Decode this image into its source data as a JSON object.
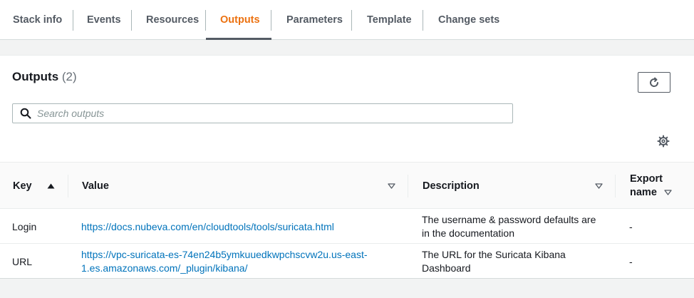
{
  "tabs": [
    {
      "label": "Stack info"
    },
    {
      "label": "Events"
    },
    {
      "label": "Resources"
    },
    {
      "label": "Outputs"
    },
    {
      "label": "Parameters"
    },
    {
      "label": "Template"
    },
    {
      "label": "Change sets"
    }
  ],
  "panel": {
    "title": "Outputs",
    "count": "(2)"
  },
  "search": {
    "placeholder": "Search outputs"
  },
  "table": {
    "headers": {
      "key": "Key",
      "value": "Value",
      "description": "Description",
      "export_line1": "Export",
      "export_line2": "name"
    },
    "rows": [
      {
        "key": "Login",
        "value_line1": "https://docs.nubeva.com/en/cloudtools/tools/suricata.html",
        "value_line2": "",
        "desc_line1": "The username & password defaults are",
        "desc_line2": "in the documentation",
        "export": "-"
      },
      {
        "key": "URL",
        "value_line1": "https://vpc-suricata-es-74en24b5ymkuuedkwpchscvw2u.us-east-",
        "value_line2": "1.es.amazonaws.com/_plugin/kibana/",
        "desc_line1": "The URL for the Suricata Kibana",
        "desc_line2": "Dashboard",
        "export": "-"
      }
    ]
  },
  "icons": {
    "search": "search-icon",
    "refresh": "refresh-icon",
    "settings": "gear-icon",
    "sort_asc": "caret-up-icon",
    "sort_neutral": "caret-down-outline-icon"
  },
  "colors": {
    "active_tab": "#ec7211",
    "link": "#0073bb",
    "text": "#16191f",
    "muted": "#545b64",
    "background": "#f2f3f3"
  }
}
